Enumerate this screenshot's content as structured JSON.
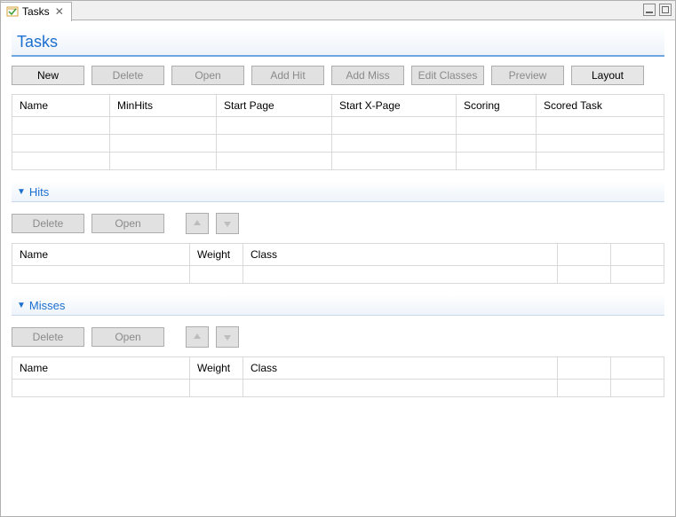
{
  "tab": {
    "label": "Tasks"
  },
  "header": {
    "title": "Tasks"
  },
  "toolbar": {
    "new": "New",
    "delete": "Delete",
    "open": "Open",
    "addHit": "Add Hit",
    "addMiss": "Add Miss",
    "editClasses": "Edit Classes",
    "preview": "Preview",
    "layout": "Layout"
  },
  "tasksTable": {
    "columns": [
      "Name",
      "MinHits",
      "Start Page",
      "Start X-Page",
      "Scoring",
      "Scored Task"
    ],
    "rows": []
  },
  "hits": {
    "title": "Hits",
    "buttons": {
      "delete": "Delete",
      "open": "Open"
    },
    "columns": [
      "Name",
      "Weight",
      "Class",
      "",
      ""
    ],
    "rows": []
  },
  "misses": {
    "title": "Misses",
    "buttons": {
      "delete": "Delete",
      "open": "Open"
    },
    "columns": [
      "Name",
      "Weight",
      "Class",
      "",
      ""
    ],
    "rows": []
  }
}
